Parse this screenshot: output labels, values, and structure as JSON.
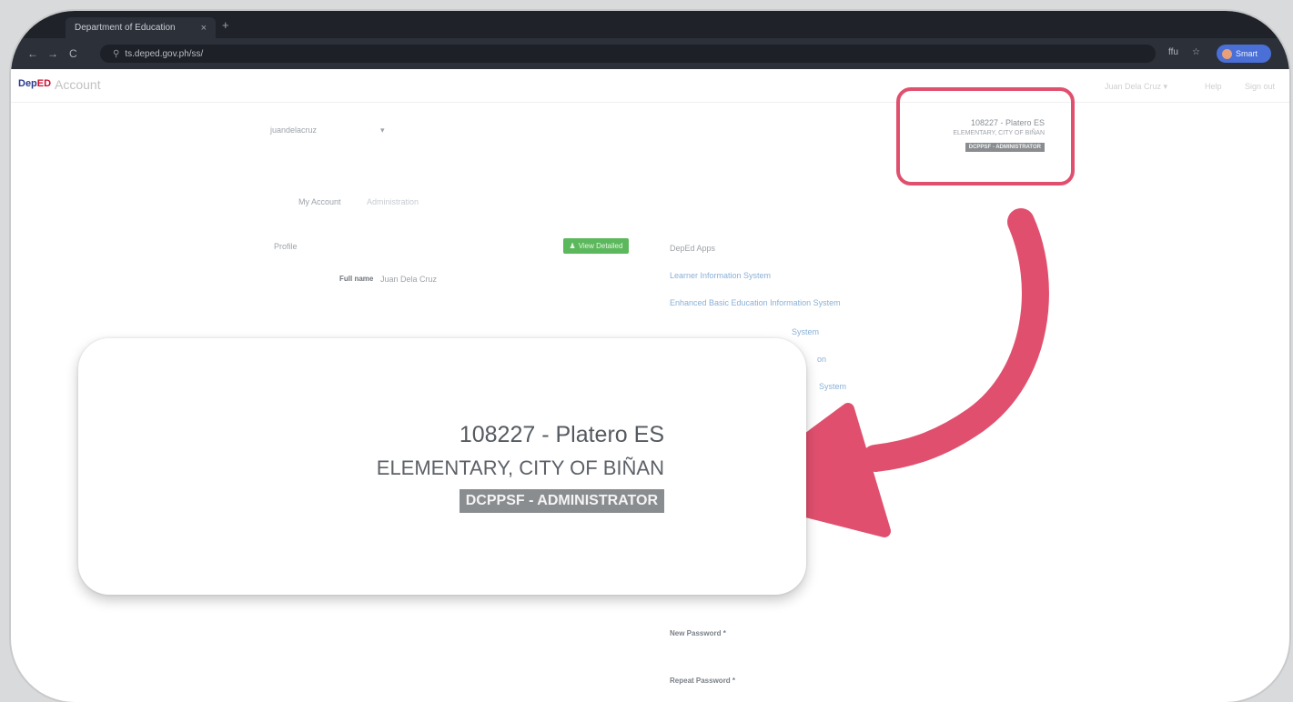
{
  "browser": {
    "tab_title": "Department of Education",
    "tab_close": "×",
    "new_tab": "+",
    "back": "←",
    "forward": "→",
    "reload": "C",
    "url": "ts.deped.gov.ph/ss/",
    "lang": "ffu",
    "star": "☆",
    "profile_label": "Smart"
  },
  "app": {
    "logo_a": "Dep",
    "logo_b": "ED",
    "brand": "Account",
    "nav": [
      "Juan Dela Cruz ▾",
      "Help",
      "Sign out"
    ]
  },
  "page": {
    "username": "juandelacruz",
    "username_caret": "▾",
    "tabs": [
      "My Account",
      "Administration"
    ],
    "profile_heading": "Profile",
    "view_detailed_label": "View Detailed",
    "fullname_label": "Full name",
    "fullname_value": "Juan Dela Cruz",
    "apps_heading": "DepEd Apps",
    "apps": [
      "Learner Information System",
      "Enhanced Basic Education Information System",
      "System",
      "on",
      "System"
    ],
    "new_password_label": "New Password *",
    "repeat_password_label": "Repeat Password *"
  },
  "school": {
    "id_name": "108227 - Platero ES",
    "district": "ELEMENTARY, CITY OF BIÑAN",
    "role": "DCPPSF - ADMINISTRATOR"
  },
  "colors": {
    "highlight": "#e0506e",
    "button_green": "#5cb85c",
    "role_badge": "#8a8d90"
  },
  "icons": {
    "arrow": "curved-arrow-icon",
    "user": "user-icon"
  }
}
